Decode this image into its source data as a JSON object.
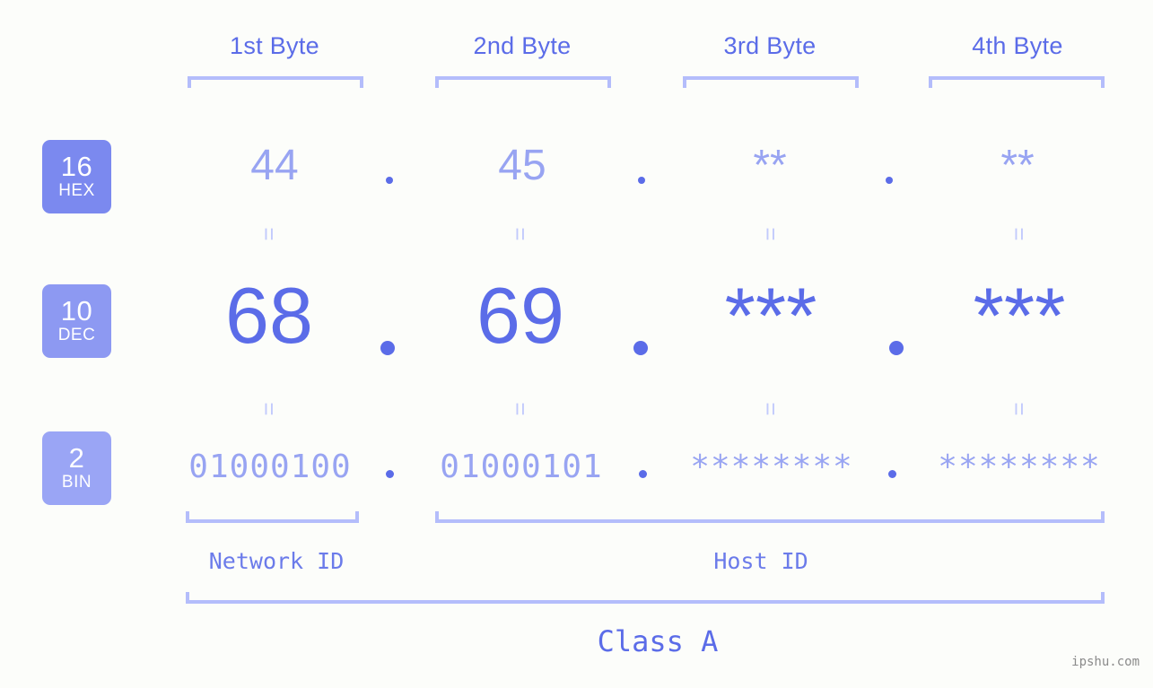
{
  "page": {
    "background": "#fcfdfa",
    "watermark": "ipshu.com"
  },
  "colors": {
    "strong_blue": "#5b6ce8",
    "light_blue": "#98a4f2",
    "pale_blue": "#b4bdfb",
    "faint_blue": "#c2cafc",
    "badge_hex": "#7b89ef",
    "badge_dec": "#8d99f2",
    "badge_bin": "#9aa5f5",
    "watermark_gray": "#8b8b8b"
  },
  "byte_headers": [
    {
      "label": "1st Byte"
    },
    {
      "label": "2nd Byte"
    },
    {
      "label": "3rd Byte"
    },
    {
      "label": "4th Byte"
    }
  ],
  "radix_badges": [
    {
      "number": "16",
      "name": "HEX",
      "color": "#7b89ef"
    },
    {
      "number": "10",
      "name": "DEC",
      "color": "#8d99f2"
    },
    {
      "number": "2",
      "name": "BIN",
      "color": "#9aa5f5"
    }
  ],
  "rows": {
    "hex": {
      "radix": "16",
      "radix_name": "HEX",
      "values": [
        "44",
        "45",
        "**",
        "**"
      ],
      "separator": "."
    },
    "dec": {
      "radix": "10",
      "radix_name": "DEC",
      "values": [
        "68",
        "69",
        "***",
        "***"
      ],
      "separator": "."
    },
    "bin": {
      "radix": "2",
      "radix_name": "BIN",
      "values": [
        "01000100",
        "01000101",
        "********",
        "********"
      ],
      "separator": "."
    }
  },
  "equals": {
    "glyph": "=",
    "count_per_row": 4
  },
  "id_sections": [
    {
      "label": "Network ID"
    },
    {
      "label": "Host ID"
    }
  ],
  "class_section": {
    "label": "Class A"
  }
}
